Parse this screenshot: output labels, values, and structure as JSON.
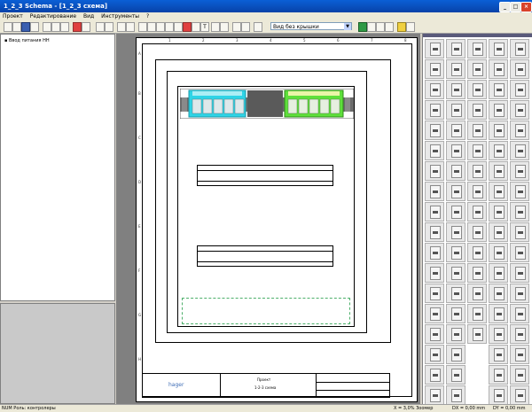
{
  "window": {
    "title": "1_2_3 Schema - [1_2_3 схема]",
    "minimize": "_",
    "maximize": "□",
    "close": "×"
  },
  "menu": [
    "Проект",
    "Редактирование",
    "Вид",
    "Инструменты",
    "?"
  ],
  "toolbar": {
    "view_select": "Вид без крышки",
    "text_tool": "T"
  },
  "tree": {
    "item": "Ввод питания НН"
  },
  "sheet": {
    "col_labels": [
      "1",
      "2",
      "3",
      "4",
      "5",
      "6",
      "7",
      "8"
    ],
    "row_labels": [
      "A",
      "B",
      "C",
      "D",
      "E",
      "F",
      "G",
      "H"
    ],
    "title_block": {
      "brand": "hager",
      "project_label": "Проект",
      "project_name": "1-2-3 схема"
    }
  },
  "status": {
    "left": "NUM  Роль: контролеры",
    "mid": "X = 3,0% Зоомер",
    "dx": "DX = 0,00 mm",
    "dy": "DY = 0,00 mm"
  },
  "colors": {
    "cyan_module": "#2fd4e6",
    "green_module": "#5ee03a",
    "hager_blue": "#3d6cb5"
  }
}
